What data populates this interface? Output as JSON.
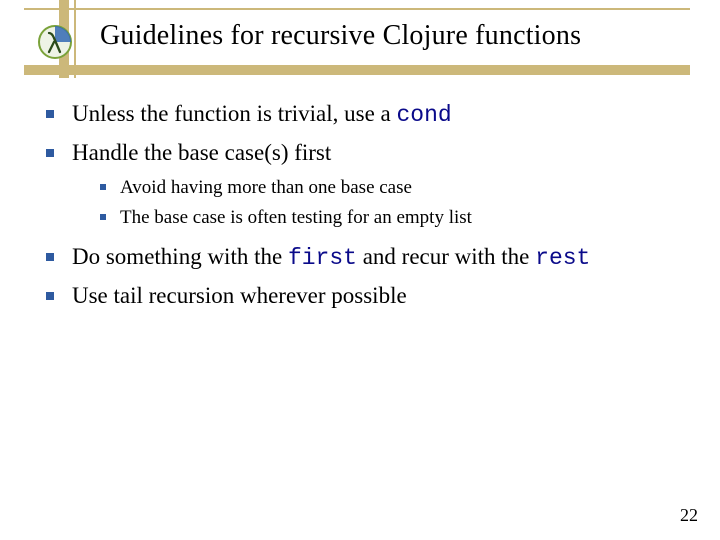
{
  "title": "Guidelines for recursive Clojure functions",
  "bullets": {
    "0": {
      "pre": "Unless the function is trivial, use a ",
      "code": "cond"
    },
    "1": {
      "text": "Handle the base case(s) first",
      "sub": {
        "0": "Avoid having more than one base case",
        "1": "The base case is often testing for an empty list"
      }
    },
    "2": {
      "pre": "Do something with the ",
      "code1": "first",
      "mid": " and recur with the ",
      "code2": "rest"
    },
    "3": {
      "text": "Use tail recursion wherever possible"
    }
  },
  "page_number": "22",
  "colors": {
    "accent_rule": "#ccb87a",
    "bullet": "#2e5aa0",
    "code": "#0a0a8a"
  }
}
